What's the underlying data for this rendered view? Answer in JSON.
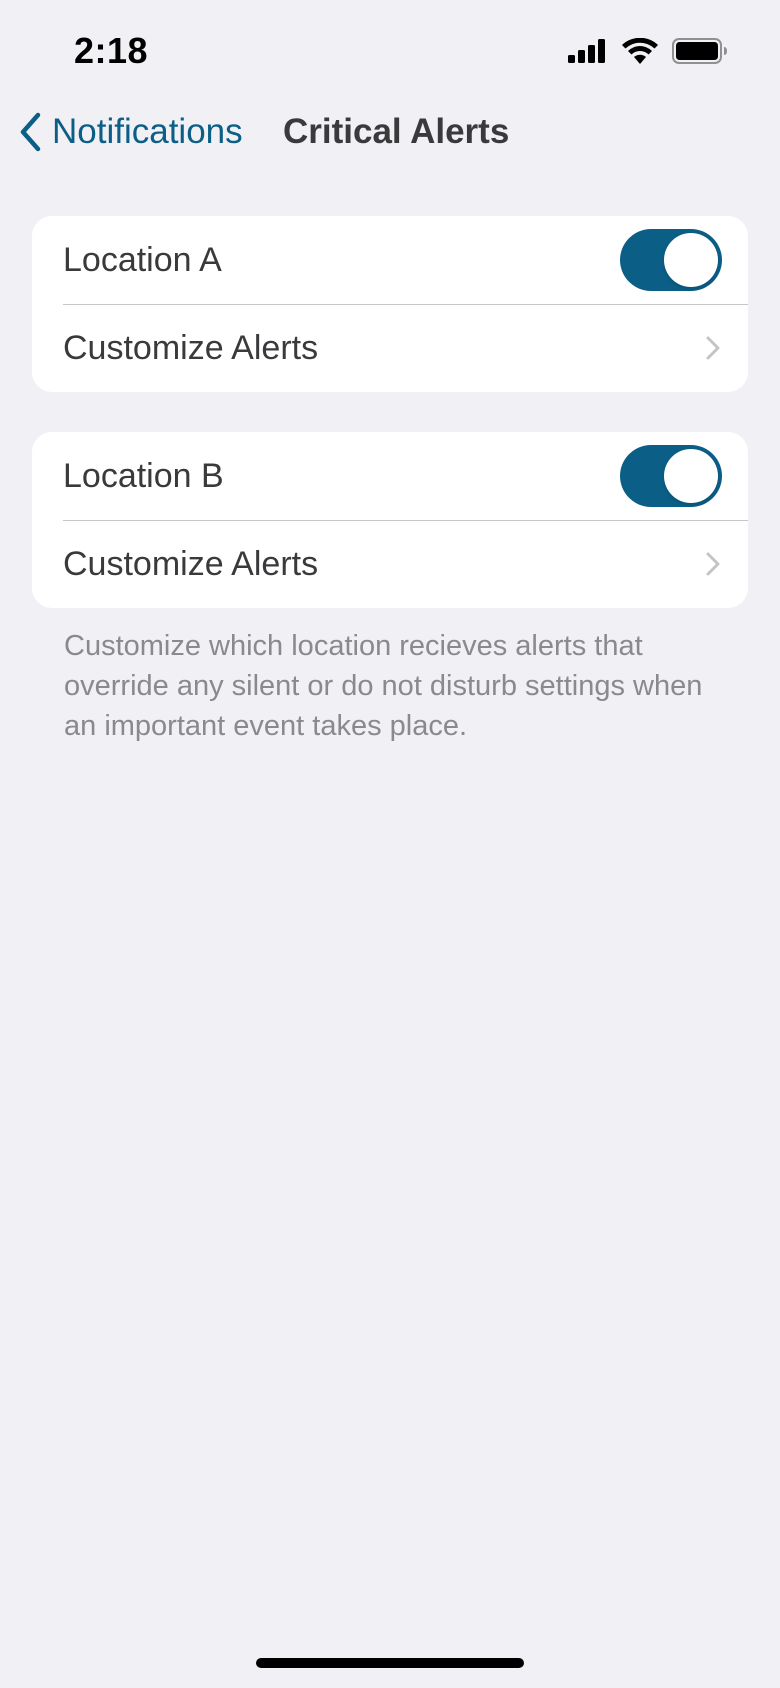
{
  "status_bar": {
    "time": "2:18",
    "icons": [
      "cellular-signal-icon",
      "wifi-icon",
      "battery-icon"
    ]
  },
  "nav": {
    "back_label": "Notifications",
    "title": "Critical Alerts"
  },
  "groups": [
    {
      "location_label": "Location A",
      "toggle_on": true,
      "customize_label": "Customize Alerts"
    },
    {
      "location_label": "Location B",
      "toggle_on": true,
      "customize_label": "Customize Alerts"
    }
  ],
  "footnote": "Customize which location recieves alerts that override any silent or do not disturb settings when an important event takes place.",
  "colors": {
    "accent": "#0b5f87",
    "background": "#f0f0f5",
    "footnote": "#8a8a8e"
  }
}
